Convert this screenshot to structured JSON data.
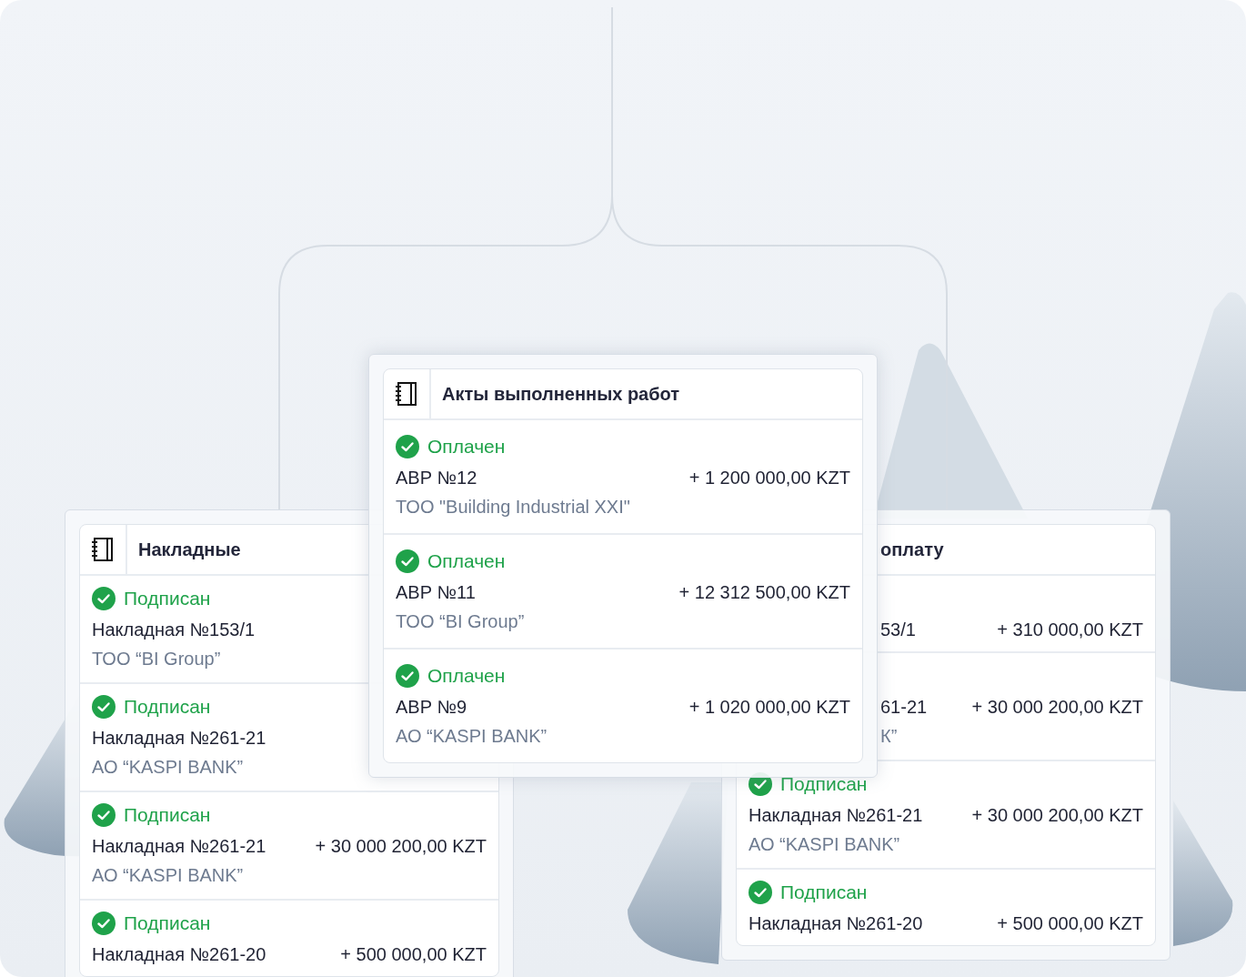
{
  "panels": [
    {
      "kind": "center",
      "title": "Акты выполненных работ",
      "partial": false,
      "rows": [
        {
          "status": "Оплачен",
          "title": "АВР №12",
          "amount": "+ 1 200 000,00 KZT",
          "subtitle": "ТОО \"Building Industrial XXI\""
        },
        {
          "status": "Оплачен",
          "title": "АВР №11",
          "amount": "+ 12 312 500,00 KZT",
          "subtitle": "ТОО “BI Group”"
        },
        {
          "status": "Оплачен",
          "title": "АВР №9",
          "amount": "+ 1 020 000,00 KZT",
          "subtitle": "АО “KASPI BANK”"
        }
      ]
    },
    {
      "kind": "left",
      "title": "Накладные",
      "partial": false,
      "rows": [
        {
          "status": "Подписан",
          "title": "Накладная №153/1",
          "subtitle": "ТОО “BI Group”"
        },
        {
          "status": "Подписан",
          "title": "Накладная №261-21",
          "subtitle": "АО “KASPI BANK”"
        },
        {
          "status": "Подписан",
          "title": "Накладная №261-21",
          "amount": "+ 30 000 200,00 KZT",
          "subtitle": "АО “KASPI BANK”"
        },
        {
          "status": "Подписан",
          "title": "Накладная №261-20",
          "amount": "+ 500 000,00 KZT"
        }
      ]
    },
    {
      "kind": "right",
      "title": "оплату",
      "partial": true,
      "rows": [
        {
          "title": "53/1",
          "amount": "+ 310 000,00 KZT",
          "partial": true
        },
        {
          "title": "61-21",
          "amount": "+ 30 000 200,00 KZT",
          "subtitle": "К”",
          "partial": true
        },
        {
          "status": "Подписан",
          "title": "Накладная №261-21",
          "amount": "+ 30 000 200,00 KZT",
          "subtitle": "АО “KASPI BANK”"
        },
        {
          "status": "Подписан",
          "title": "Накладная №261-20",
          "amount": "+ 500 000,00 KZT"
        }
      ]
    }
  ]
}
